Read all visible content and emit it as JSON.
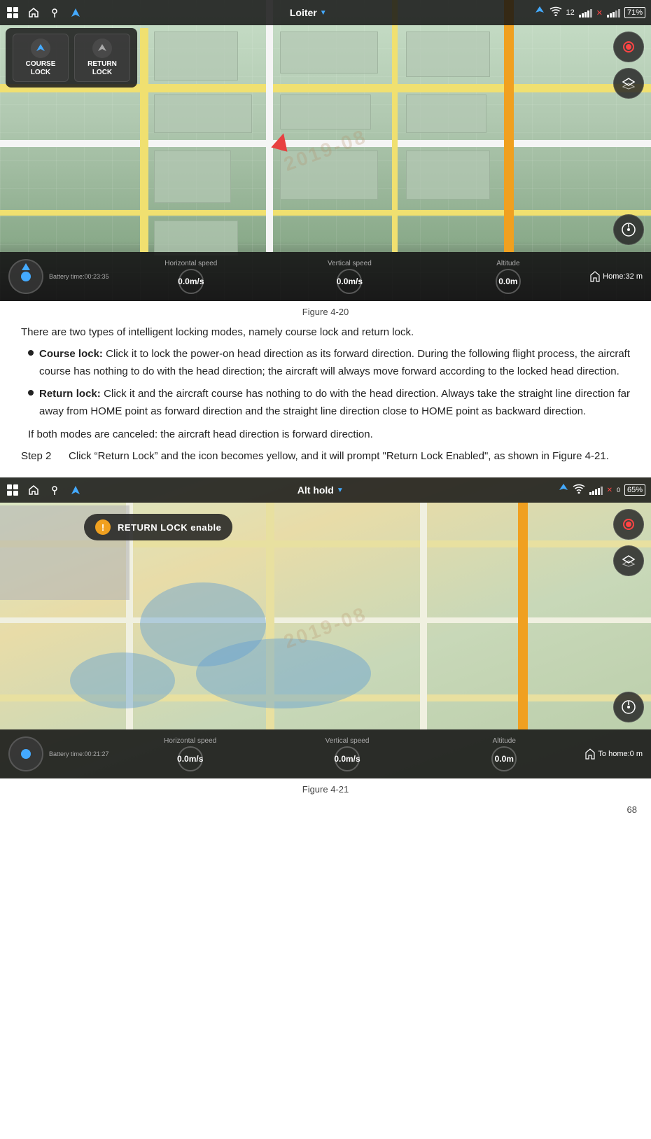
{
  "figure20": {
    "caption": "Figure 4-20",
    "topbar": {
      "title": "Loiter",
      "battery": "71%",
      "mode_icons": [
        "grid-icon",
        "home-icon",
        "map-pin-icon",
        "compass-icon"
      ]
    },
    "overlay": {
      "course_lock_label": "COURSE\nLOCK",
      "return_lock_label": "RETURN\nLOCK"
    },
    "bottom": {
      "battery_time": "Battery time:00:23:35",
      "horizontal_speed_label": "Horizontal speed",
      "horizontal_speed_value": "0.0m/s",
      "vertical_speed_label": "Vertical speed",
      "vertical_speed_value": "0.0m/s",
      "altitude_label": "Altitude",
      "altitude_value": "0.0m",
      "home_label": "Home:32 m"
    }
  },
  "text": {
    "intro": "There are two types of intelligent locking modes, namely course lock and return lock.",
    "bullet1_label": "Course lock:",
    "bullet1_text": "Click it to lock the power-on head direction as its forward direction. During the following flight process, the aircraft course has nothing to do with the head direction; the aircraft will always move forward according to the locked head direction.",
    "bullet2_label": "Return lock:",
    "bullet2_text": "Click it and the aircraft course has nothing to do with the head direction. Always take the straight line direction far away from HOME point as forward direction and the straight line direction close to HOME point as backward direction.",
    "both_modes": "If both modes are canceled: the aircraft head direction is forward direction.",
    "step2_label": "Step 2",
    "step2_text": "Click “Return Lock” and the icon becomes yellow, and it will prompt \"Return Lock Enabled\", as shown in Figure 4-21."
  },
  "figure21": {
    "caption": "Figure 4-21",
    "topbar": {
      "title": "Alt hold",
      "battery": "65%"
    },
    "toast": {
      "text": "RETURN LOCK enable"
    },
    "bottom": {
      "battery_time": "Battery time:00:21:27",
      "horizontal_speed_label": "Horizontal speed",
      "horizontal_speed_value": "0.0m/s",
      "vertical_speed_label": "Vertical speed",
      "vertical_speed_value": "0.0m/s",
      "altitude_label": "Altitude",
      "altitude_value": "0.0m",
      "home_label": "To home:0 m"
    }
  },
  "page": {
    "number": "68"
  },
  "watermark": "2019-08"
}
